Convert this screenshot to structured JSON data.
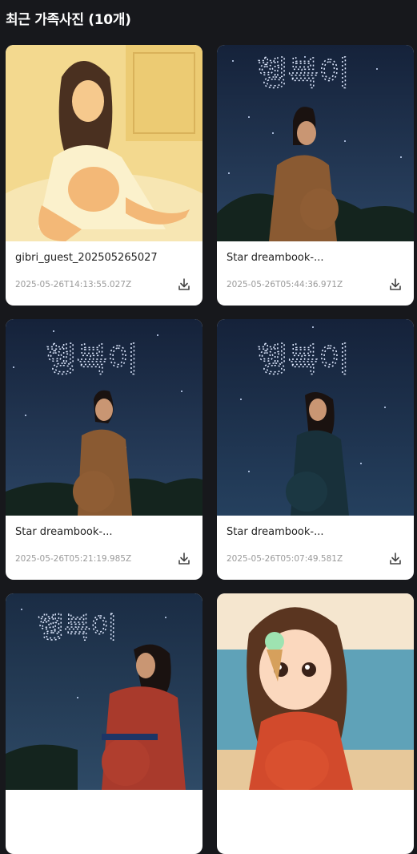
{
  "section": {
    "title": "최근 가족사진 (10개)"
  },
  "photos": [
    {
      "name": "gibri_guest_202505265027",
      "date": "2025-05-26T14:13:55.027Z",
      "style": "warm"
    },
    {
      "name": "Star dreambook-...",
      "date": "2025-05-26T05:44:36.971Z",
      "style": "night",
      "sky_text": "행복이"
    },
    {
      "name": "Star dreambook-...",
      "date": "2025-05-26T05:21:19.985Z",
      "style": "night",
      "sky_text": "행복이"
    },
    {
      "name": "Star dreambook-...",
      "date": "2025-05-26T05:07:49.581Z",
      "style": "night",
      "sky_text": "행복이"
    },
    {
      "name": "",
      "date": "",
      "style": "night",
      "sky_text": "행복이"
    },
    {
      "name": "",
      "date": "",
      "style": "beach"
    }
  ],
  "icons": {
    "download": "download-icon"
  },
  "colors": {
    "background": "#17181c",
    "card": "#ffffff",
    "night_sky": "#1c2a44",
    "warm_bg": "#f3d98f"
  }
}
